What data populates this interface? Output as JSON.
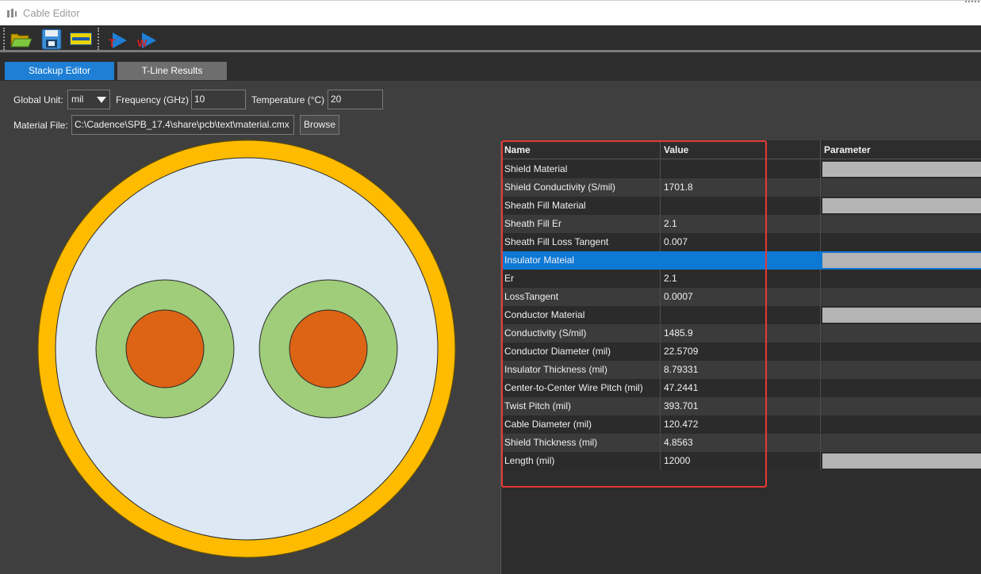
{
  "window": {
    "title": "Cable Editor"
  },
  "toolbar": {
    "buttons": [
      {
        "name": "open-folder-icon"
      },
      {
        "name": "save-icon"
      },
      {
        "name": "layer-icon"
      },
      {
        "name": "export-t-icon"
      },
      {
        "name": "export-w-icon"
      }
    ]
  },
  "tabs": [
    {
      "label": "Stackup Editor",
      "active": true
    },
    {
      "label": "T-Line Results",
      "active": false
    }
  ],
  "controls": {
    "global_unit_label": "Global Unit:",
    "global_unit_value": "mil",
    "frequency_label": "Frequency (GHz)",
    "frequency_value": "10",
    "temperature_label": "Temperature (°C)",
    "temperature_value": "20",
    "material_file_label": "Material File:",
    "material_file_value": "C:\\Cadence\\SPB_17.4\\share\\pcb\\text\\material.cmx",
    "browse_label": "Browse"
  },
  "cross_section": {
    "colors": {
      "shield": "#ffbb00",
      "sheath_fill": "#dce8f4",
      "insulator": "#9fcd7a",
      "conductor": "#dc6414"
    }
  },
  "grid": {
    "headers": {
      "name": "Name",
      "value": "Value",
      "parameter": "Parameter"
    },
    "rows": [
      {
        "name": "Shield Material",
        "value": "",
        "has_param": true
      },
      {
        "name": "Shield Conductivity (S/mil)",
        "value": "1701.8",
        "has_param": false
      },
      {
        "name": "Sheath Fill Material",
        "value": "",
        "has_param": true
      },
      {
        "name": "Sheath Fill Er",
        "value": "2.1",
        "has_param": false
      },
      {
        "name": "Sheath Fill Loss Tangent",
        "value": "0.007",
        "has_param": false
      },
      {
        "name": "Insulator Mateial",
        "value": "",
        "has_param": true,
        "selected": true
      },
      {
        "name": "Er",
        "value": "2.1",
        "has_param": false
      },
      {
        "name": "LossTangent",
        "value": "0.0007",
        "has_param": false
      },
      {
        "name": "Conductor Material",
        "value": "",
        "has_param": true
      },
      {
        "name": "Conductivity (S/mil)",
        "value": "1485.9",
        "has_param": false
      },
      {
        "name": "Conductor Diameter (mil)",
        "value": "22.5709",
        "has_param": false
      },
      {
        "name": "Insulator Thickness (mil)",
        "value": "8.79331",
        "has_param": false
      },
      {
        "name": "Center-to-Center Wire Pitch (mil)",
        "value": "47.2441",
        "has_param": false
      },
      {
        "name": "Twist Pitch (mil)",
        "value": "393.701",
        "has_param": false
      },
      {
        "name": "Cable Diameter (mil)",
        "value": "120.472",
        "has_param": false
      },
      {
        "name": "Shield Thickness (mil)",
        "value": "4.8563",
        "has_param": false
      },
      {
        "name": "Length (mil)",
        "value": "12000",
        "has_param": true
      }
    ]
  }
}
